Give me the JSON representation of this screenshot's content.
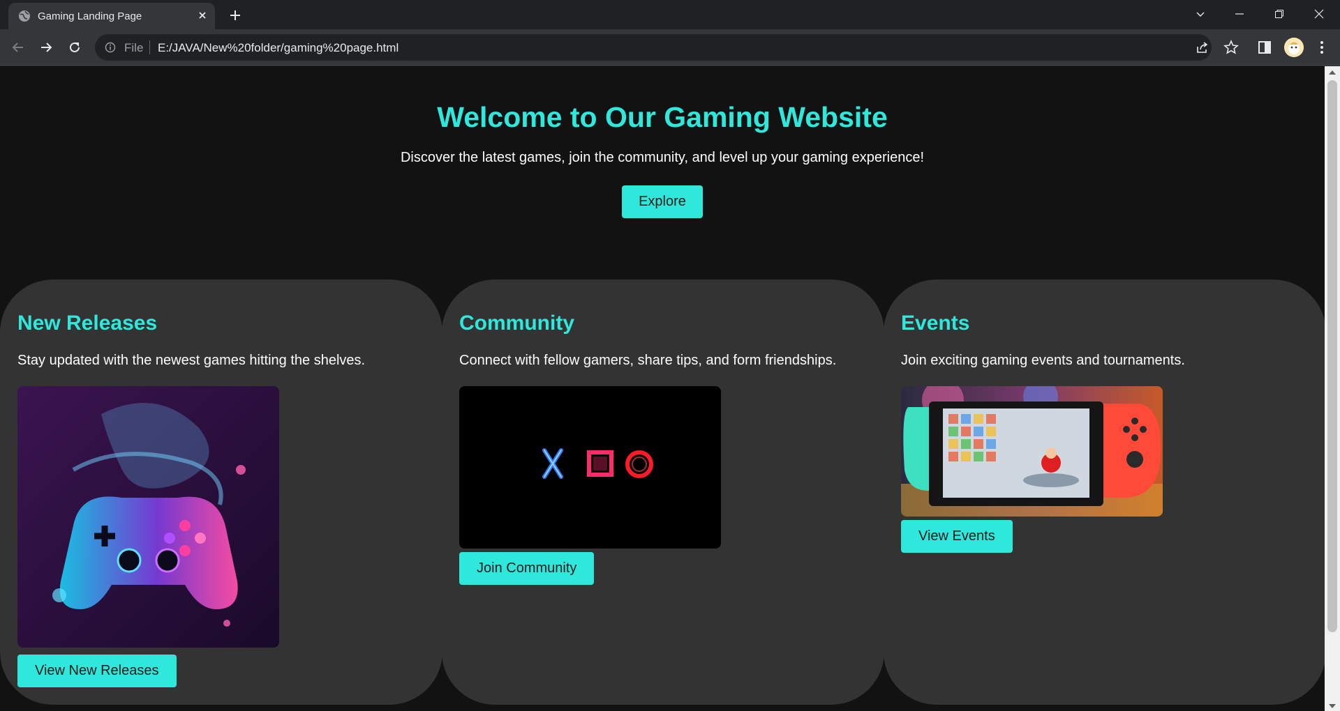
{
  "browser": {
    "tab_title": "Gaming Landing Page",
    "file_label": "File",
    "url": "E:/JAVA/New%20folder/gaming%20page.html"
  },
  "hero": {
    "title": "Welcome to Our Gaming Website",
    "subtitle": "Discover the latest games, join the community, and level up your gaming experience!",
    "button_label": "Explore"
  },
  "cards": [
    {
      "title": "New Releases",
      "text": "Stay updated with the newest games hitting the shelves.",
      "button_label": "View New Releases",
      "image": "neon-gamepad-image"
    },
    {
      "title": "Community",
      "text": "Connect with fellow gamers, share tips, and form friendships.",
      "button_label": "Join Community",
      "image": "neon-controller-symbols-image"
    },
    {
      "title": "Events",
      "text": "Join exciting gaming events and tournaments.",
      "button_label": "View Events",
      "image": "handheld-console-image"
    }
  ],
  "colors": {
    "accent": "#2ee8dc",
    "card_bg": "#333333",
    "page_bg": "#121212"
  }
}
